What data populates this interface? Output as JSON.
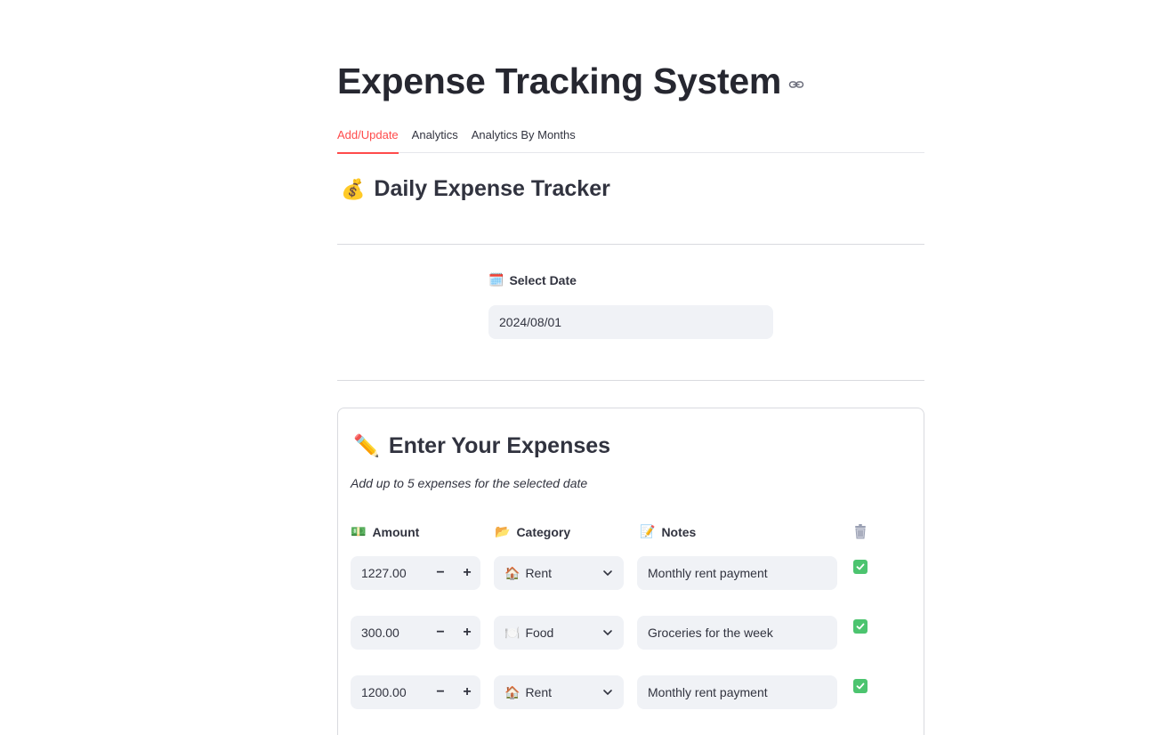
{
  "app": {
    "title": "Expense Tracking System"
  },
  "tabs": [
    {
      "label": "Add/Update",
      "active": true
    },
    {
      "label": "Analytics",
      "active": false
    },
    {
      "label": "Analytics By Months",
      "active": false
    }
  ],
  "tracker": {
    "emoji": "💰",
    "heading": "Daily Expense Tracker"
  },
  "date": {
    "emoji": "🗓️",
    "label": "Select Date",
    "value": "2024/08/01"
  },
  "expenses": {
    "emoji": "✏️",
    "heading": "Enter Your Expenses",
    "subtitle": "Add up to 5 expenses for the selected date",
    "columns": {
      "amount": {
        "emoji": "💵",
        "label": "Amount"
      },
      "category": {
        "emoji": "📂",
        "label": "Category"
      },
      "notes": {
        "emoji": "📝",
        "label": "Notes"
      },
      "delete_icon": "trash-icon"
    },
    "rows": [
      {
        "amount": "1227.00",
        "category_emoji": "🏠",
        "category": "Rent",
        "notes": "Monthly rent payment",
        "checked": true
      },
      {
        "amount": "300.00",
        "category_emoji": "🍽️",
        "category": "Food",
        "notes": "Groceries for the week",
        "checked": true
      },
      {
        "amount": "1200.00",
        "category_emoji": "🏠",
        "category": "Rent",
        "notes": "Monthly rent payment",
        "checked": true
      }
    ],
    "stepper": {
      "minus": "−",
      "plus": "+"
    }
  },
  "colors": {
    "accent": "#ff4b4b",
    "input_bg": "#f0f2f6",
    "check_green": "#4cc46f",
    "text": "#31333f"
  }
}
